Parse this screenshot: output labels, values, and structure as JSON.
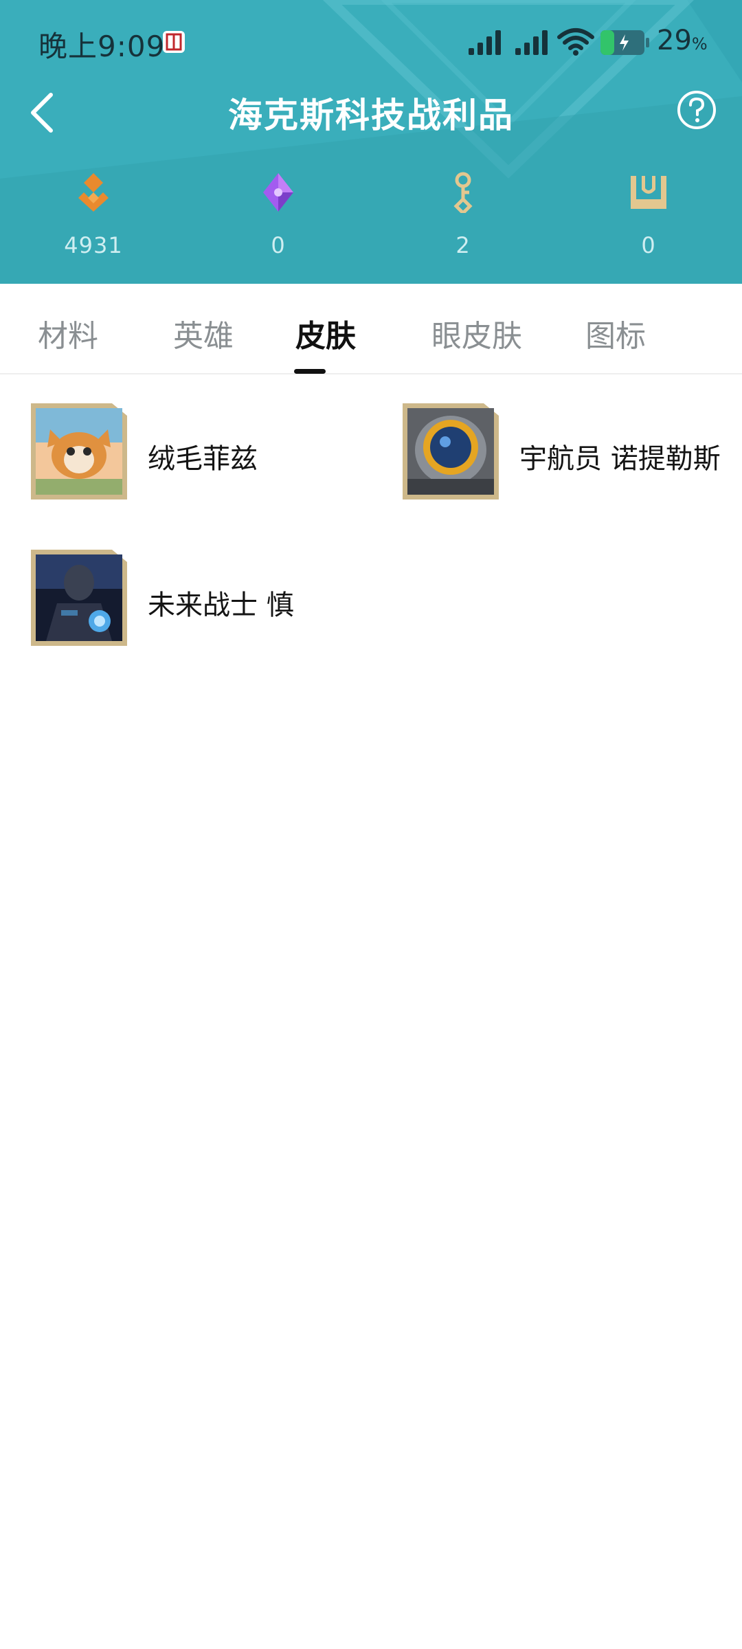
{
  "status_bar": {
    "time": "晚上9:09",
    "battery_value": "29",
    "battery_unit": "%"
  },
  "nav": {
    "title": "海克斯科技战利品"
  },
  "currencies": [
    {
      "icon": "orange-essence-icon",
      "value": "4931",
      "color": "#e98a2e"
    },
    {
      "icon": "purple-gem-icon",
      "value": "0",
      "color": "#a35cf0"
    },
    {
      "icon": "key-icon",
      "value": "2",
      "color": "#e3c78f"
    },
    {
      "icon": "chest-icon",
      "value": "0",
      "color": "#e3c78f"
    }
  ],
  "tabs": [
    {
      "label": "材料",
      "active": false
    },
    {
      "label": "英雄",
      "active": false
    },
    {
      "label": "皮肤",
      "active": true
    },
    {
      "label": "眼皮肤",
      "active": false
    },
    {
      "label": "图标",
      "active": false
    }
  ],
  "skins": [
    {
      "name": "绒毛菲兹",
      "thumb_palette": [
        "#f3c79b",
        "#7fb9d8",
        "#e0913f"
      ]
    },
    {
      "name": "宇航员 诺提勒斯",
      "thumb_palette": [
        "#7a7f86",
        "#e5a522",
        "#1f3f72"
      ]
    },
    {
      "name": "未来战士 慎",
      "thumb_palette": [
        "#2a3d68",
        "#4ea8e8",
        "#141b2f"
      ]
    }
  ],
  "colors": {
    "header_bg": "#34a7b5",
    "accent_dark": "#111111",
    "thumb_frame": "#cdb88a"
  }
}
